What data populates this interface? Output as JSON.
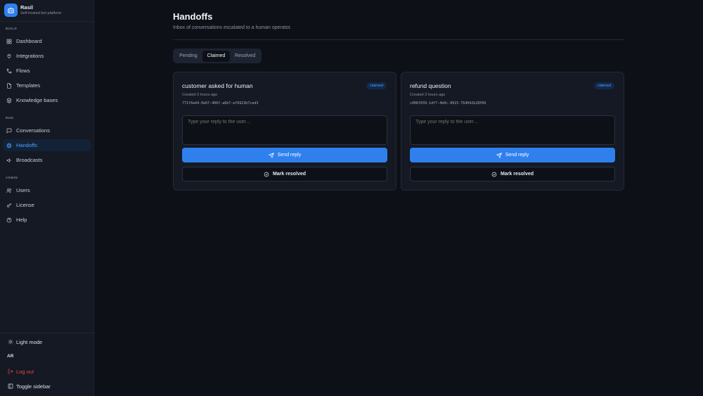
{
  "brand": {
    "name": "Rasil",
    "subtitle": "Self-hosted bot platform"
  },
  "sidebar": {
    "sections": [
      {
        "label": "BUILD"
      },
      {
        "label": "RUN"
      },
      {
        "label": "ADMIN"
      }
    ],
    "items": [
      {
        "label": "Dashboard",
        "icon": "grid-icon"
      },
      {
        "label": "Integrations",
        "icon": "plug-icon"
      },
      {
        "label": "Flows",
        "icon": "flow-icon"
      },
      {
        "label": "Templates",
        "icon": "file-icon"
      },
      {
        "label": "Knowledge bases",
        "icon": "book-icon"
      },
      {
        "label": "Conversations",
        "icon": "chat-icon"
      },
      {
        "label": "Handoffs",
        "icon": "life-buoy-icon",
        "active": true
      },
      {
        "label": "Broadcasts",
        "icon": "megaphone-icon"
      },
      {
        "label": "Users",
        "icon": "users-icon"
      },
      {
        "label": "License",
        "icon": "key-icon"
      },
      {
        "label": "Help",
        "icon": "help-icon"
      }
    ],
    "bottom": {
      "theme_label": "Light mode",
      "avatar": "AR",
      "logout_label": "Log out",
      "toggle_label": "Toggle sidebar"
    }
  },
  "main": {
    "title": "Handoffs",
    "subtitle": "Inbox of conversations escalated to a human operator.",
    "tabs": [
      {
        "label": "Pending"
      },
      {
        "label": "Claimed",
        "active": true
      },
      {
        "label": "Resolved"
      }
    ],
    "cards": [
      {
        "title": "customer asked for human",
        "badge": "claimed",
        "created": "Created 3 hours ago",
        "id": "771f4a44-0e67-406f-a6b7-ef6923b7ced3",
        "reply_placeholder": "Type your reply to the user…",
        "send_label": "Send reply",
        "resolve_label": "Mark resolved"
      },
      {
        "title": "refund question",
        "badge": "claimed",
        "created": "Created 3 hours ago",
        "id": "c006f039-1df7-4b0c-8915-764042b28509",
        "reply_placeholder": "Type your reply to the user…",
        "send_label": "Send reply",
        "resolve_label": "Mark resolved"
      }
    ]
  },
  "colors": {
    "accent": "#2f80ed",
    "active_text": "#4aa3ff",
    "danger": "#e5484d",
    "background": "#0d1117"
  }
}
